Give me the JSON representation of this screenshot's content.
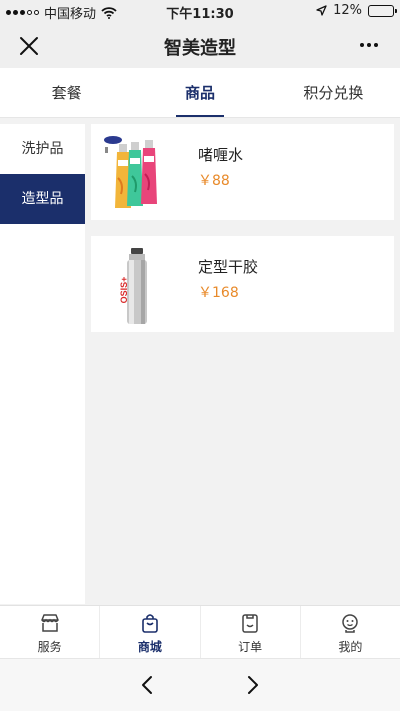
{
  "status_bar": {
    "carrier": "中国移动",
    "time": "下午11:30",
    "battery": "12%",
    "battery_level": 0.12
  },
  "navbar": {
    "title": "智美造型",
    "close_icon": "close-icon",
    "more_icon": "more-icon"
  },
  "tabs": [
    {
      "label": "套餐",
      "active": false
    },
    {
      "label": "商品",
      "active": true
    },
    {
      "label": "积分兑换",
      "active": false
    }
  ],
  "categories": [
    {
      "label": "洗护品",
      "active": false
    },
    {
      "label": "造型品",
      "active": true
    }
  ],
  "products": [
    {
      "name": "啫喱水",
      "price": "￥88",
      "image": "hair-gel-bottles"
    },
    {
      "name": "定型干胶",
      "price": "￥168",
      "image": "hairspray-can"
    }
  ],
  "tabbar": [
    {
      "label": "服务",
      "icon": "shop-icon",
      "active": false
    },
    {
      "label": "商城",
      "icon": "bag-icon",
      "active": true
    },
    {
      "label": "订单",
      "icon": "order-icon",
      "active": false
    },
    {
      "label": "我的",
      "icon": "profile-icon",
      "active": false
    }
  ],
  "colors": {
    "accent": "#1b2f6b",
    "price": "#e88a2a",
    "background": "#f2f2f2"
  }
}
